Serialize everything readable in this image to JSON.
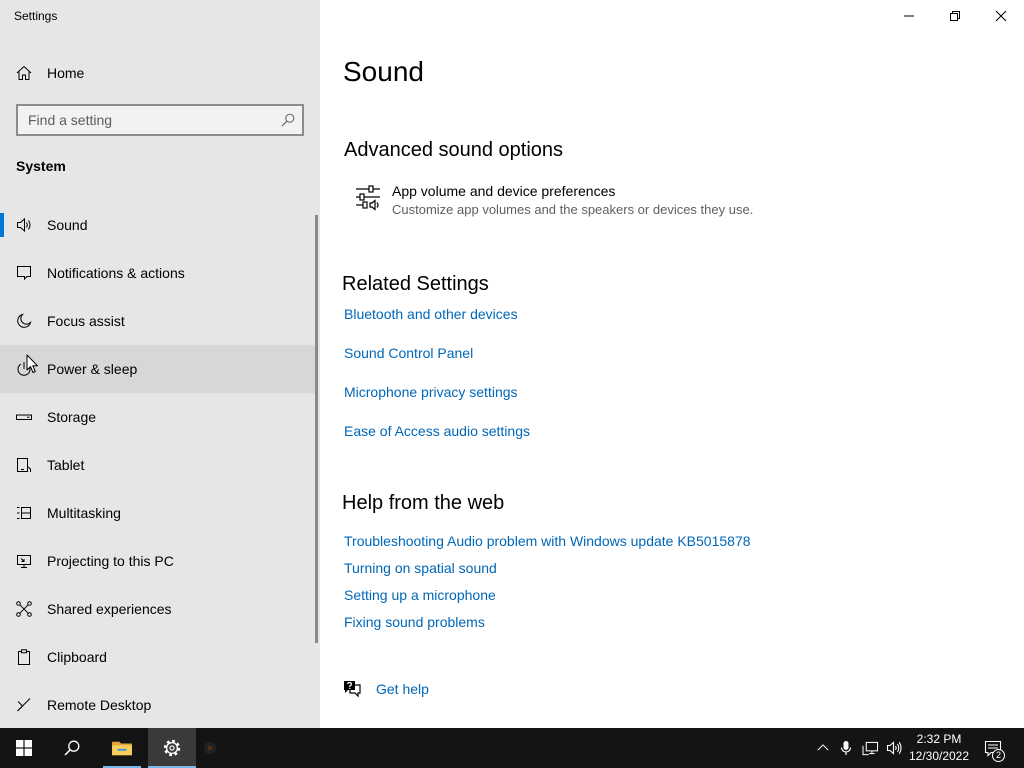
{
  "window": {
    "title": "Settings",
    "controls": [
      "minimize-icon",
      "restore-icon",
      "close-icon"
    ]
  },
  "sidebar": {
    "home": {
      "label": "Home",
      "icon": "home-icon"
    },
    "search": {
      "placeholder": "Find a setting",
      "icon": "search-icon"
    },
    "section_title": "System",
    "items": [
      {
        "label": "Sound",
        "icon": "speaker-icon",
        "selected": true
      },
      {
        "label": "Notifications & actions",
        "icon": "notification-bubble-icon"
      },
      {
        "label": "Focus assist",
        "icon": "moon-icon"
      },
      {
        "label": "Power & sleep",
        "icon": "power-icon",
        "hovered": true
      },
      {
        "label": "Storage",
        "icon": "storage-drive-icon"
      },
      {
        "label": "Tablet",
        "icon": "tablet-icon"
      },
      {
        "label": "Multitasking",
        "icon": "multitasking-icon"
      },
      {
        "label": "Projecting to this PC",
        "icon": "projecting-icon"
      },
      {
        "label": "Shared experiences",
        "icon": "shared-experiences-icon"
      },
      {
        "label": "Clipboard",
        "icon": "clipboard-icon"
      },
      {
        "label": "Remote Desktop",
        "icon": "remote-desktop-icon"
      }
    ]
  },
  "main": {
    "title": "Sound",
    "advanced": {
      "heading": "Advanced sound options",
      "item": {
        "icon": "sliders-icon",
        "title": "App volume and device preferences",
        "description": "Customize app volumes and the speakers or devices they use."
      }
    },
    "related": {
      "heading": "Related Settings",
      "links": [
        "Bluetooth and other devices",
        "Sound Control Panel",
        "Microphone privacy settings",
        "Ease of Access audio settings"
      ]
    },
    "help": {
      "heading": "Help from the web",
      "links": [
        "Troubleshooting Audio problem with Windows update KB5015878",
        "Turning on spatial sound",
        "Setting up a microphone",
        "Fixing sound problems"
      ]
    },
    "get_help": {
      "icon": "get-help-icon",
      "label": "Get help"
    }
  },
  "taskbar": {
    "start_icon": "windows-logo-icon",
    "search_icon": "taskbar-search-icon",
    "apps": [
      {
        "icon": "file-explorer-icon",
        "running": true,
        "active": false
      },
      {
        "icon": "settings-gear-icon",
        "running": true,
        "active": true
      },
      {
        "icon": "media-app-icon",
        "running": false,
        "active": false
      }
    ],
    "tray_icons": [
      "chevron-up-icon",
      "microphone-icon",
      "network-icon",
      "volume-icon"
    ],
    "clock": {
      "time": "2:32 PM",
      "date": "12/30/2022"
    },
    "notifications": {
      "icon": "action-center-icon",
      "count": "2"
    }
  },
  "colors": {
    "accent": "#0078d7",
    "link": "#0067b8",
    "sidebar_bg": "#e6e6e6",
    "hover_bg": "#d7d7d7",
    "taskbar_bg": "#141414",
    "taskbar_indicator": "#76b9ed",
    "active_app_bg": "#3a3a3a"
  }
}
